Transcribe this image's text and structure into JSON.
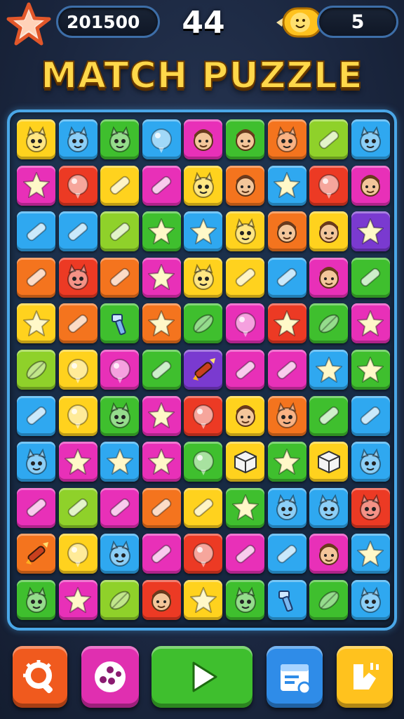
{
  "hud": {
    "score": "201500",
    "moves": "44",
    "coins": "5",
    "colors": {
      "pill_border": "#3d6ea8",
      "star": "#f0a050"
    }
  },
  "title": "MATCH PUZZLE",
  "board": {
    "rows": 11,
    "cols": 9,
    "palette": {
      "yellow": "#ffd21e",
      "blue": "#2fa8f0",
      "green": "#3fbf2e",
      "lime": "#8fd12a",
      "magenta": "#e830b8",
      "orange": "#f4741e",
      "red": "#ec3a24",
      "purple": "#7a3ad0",
      "pink": "#ff4fa8"
    },
    "tiles": [
      [
        [
          "yellow",
          "creature"
        ],
        [
          "blue",
          "creature"
        ],
        [
          "green",
          "creature"
        ],
        [
          "blue",
          "circle"
        ],
        [
          "magenta",
          "face"
        ],
        [
          "green",
          "face"
        ],
        [
          "orange",
          "creature"
        ],
        [
          "lime",
          "bar"
        ],
        [
          "blue",
          "creature"
        ]
      ],
      [
        [
          "magenta",
          "star"
        ],
        [
          "red",
          "circle"
        ],
        [
          "yellow",
          "bar"
        ],
        [
          "magenta",
          "bar"
        ],
        [
          "yellow",
          "creature"
        ],
        [
          "orange",
          "face"
        ],
        [
          "blue",
          "star"
        ],
        [
          "red",
          "circle"
        ],
        [
          "magenta",
          "face"
        ]
      ],
      [
        [
          "blue",
          "bar"
        ],
        [
          "blue",
          "bar"
        ],
        [
          "lime",
          "bar"
        ],
        [
          "green",
          "star"
        ],
        [
          "blue",
          "star"
        ],
        [
          "yellow",
          "creature"
        ],
        [
          "orange",
          "face"
        ],
        [
          "yellow",
          "face"
        ],
        [
          "purple",
          "star"
        ]
      ],
      [
        [
          "orange",
          "bar"
        ],
        [
          "red",
          "creature"
        ],
        [
          "orange",
          "bar"
        ],
        [
          "magenta",
          "star"
        ],
        [
          "yellow",
          "creature"
        ],
        [
          "yellow",
          "bar"
        ],
        [
          "blue",
          "bar"
        ],
        [
          "magenta",
          "face"
        ],
        [
          "green",
          "bar"
        ]
      ],
      [
        [
          "yellow",
          "star"
        ],
        [
          "orange",
          "bar"
        ],
        [
          "green",
          "tool"
        ],
        [
          "orange",
          "star"
        ],
        [
          "green",
          "leaf"
        ],
        [
          "magenta",
          "circle"
        ],
        [
          "red",
          "star"
        ],
        [
          "green",
          "leaf"
        ],
        [
          "magenta",
          "star"
        ]
      ],
      [
        [
          "lime",
          "leaf"
        ],
        [
          "yellow",
          "circle"
        ],
        [
          "magenta",
          "circle"
        ],
        [
          "green",
          "bar"
        ],
        [
          "purple",
          "rocket"
        ],
        [
          "magenta",
          "bar"
        ],
        [
          "magenta",
          "bar"
        ],
        [
          "blue",
          "star"
        ],
        [
          "green",
          "star"
        ]
      ],
      [
        [
          "blue",
          "bar"
        ],
        [
          "yellow",
          "circle"
        ],
        [
          "green",
          "creature"
        ],
        [
          "magenta",
          "star"
        ],
        [
          "red",
          "circle"
        ],
        [
          "yellow",
          "face"
        ],
        [
          "orange",
          "creature"
        ],
        [
          "green",
          "bar"
        ],
        [
          "blue",
          "bar"
        ]
      ],
      [
        [
          "blue",
          "creature"
        ],
        [
          "magenta",
          "star"
        ],
        [
          "blue",
          "star"
        ],
        [
          "magenta",
          "star"
        ],
        [
          "green",
          "circle"
        ],
        [
          "yellow",
          "box"
        ],
        [
          "green",
          "star"
        ],
        [
          "yellow",
          "box"
        ],
        [
          "blue",
          "creature"
        ]
      ],
      [
        [
          "magenta",
          "bar"
        ],
        [
          "lime",
          "bar"
        ],
        [
          "magenta",
          "bar"
        ],
        [
          "orange",
          "bar"
        ],
        [
          "yellow",
          "bar"
        ],
        [
          "green",
          "star"
        ],
        [
          "blue",
          "creature"
        ],
        [
          "blue",
          "creature"
        ],
        [
          "red",
          "creature"
        ]
      ],
      [
        [
          "orange",
          "rocket"
        ],
        [
          "yellow",
          "circle"
        ],
        [
          "blue",
          "creature"
        ],
        [
          "magenta",
          "bar"
        ],
        [
          "red",
          "circle"
        ],
        [
          "magenta",
          "bar"
        ],
        [
          "blue",
          "bar"
        ],
        [
          "magenta",
          "face"
        ],
        [
          "blue",
          "star"
        ]
      ],
      [
        [
          "green",
          "creature"
        ],
        [
          "magenta",
          "star"
        ],
        [
          "lime",
          "leaf"
        ],
        [
          "red",
          "face"
        ],
        [
          "yellow",
          "star"
        ],
        [
          "green",
          "creature"
        ],
        [
          "blue",
          "tool"
        ],
        [
          "green",
          "leaf"
        ],
        [
          "blue",
          "creature"
        ]
      ]
    ]
  },
  "bottom_bar": {
    "buttons": [
      {
        "name": "search",
        "color": "#f05a1e"
      },
      {
        "name": "dice",
        "color": "#e02fb0"
      },
      {
        "name": "play",
        "color": "#3fbf2e"
      },
      {
        "name": "settings-card",
        "color": "#2f8ce8"
      },
      {
        "name": "booster",
        "color": "#ffc21e"
      }
    ]
  }
}
